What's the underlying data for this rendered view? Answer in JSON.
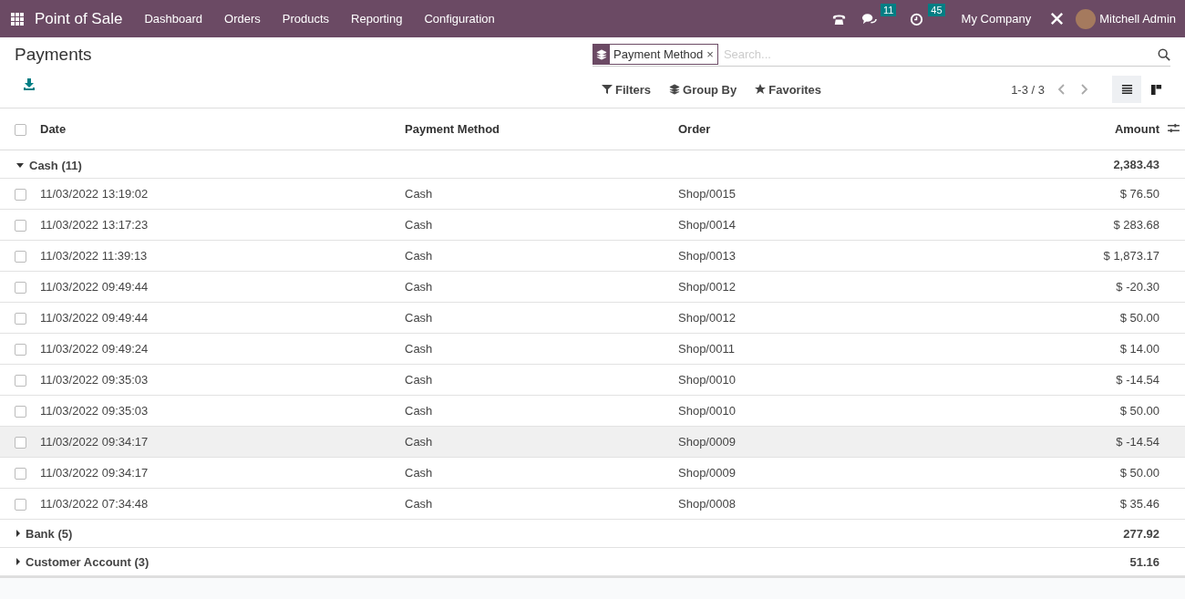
{
  "navbar": {
    "app_title": "Point of Sale",
    "menu": [
      "Dashboard",
      "Orders",
      "Products",
      "Reporting",
      "Configuration"
    ],
    "messages_count": "11",
    "activities_count": "45",
    "company": "My Company",
    "user": "Mitchell Admin"
  },
  "control_panel": {
    "title": "Payments",
    "facet": "Payment Method",
    "facet_remove": "×",
    "search": {
      "placeholder": "Search..."
    },
    "filters": "Filters",
    "group_by": "Group By",
    "favorites": "Favorites",
    "pager": "1-3 / 3",
    "views": [
      {
        "kind": "list",
        "selected": true
      },
      {
        "kind": "kanban",
        "selected": false
      }
    ]
  },
  "table": {
    "columns": [
      "Date",
      "Payment Method",
      "Order",
      "Amount"
    ],
    "select_all_checked": false,
    "groups": [
      {
        "label": "Cash (11)",
        "total": "2,383.43",
        "expanded": true,
        "rows": [
          {
            "date": "11/03/2022 13:19:02",
            "method": "Cash",
            "order": "Shop/0015",
            "amount": "$ 76.50",
            "highlighted": false
          },
          {
            "date": "11/03/2022 13:17:23",
            "method": "Cash",
            "order": "Shop/0014",
            "amount": "$ 283.68",
            "highlighted": false
          },
          {
            "date": "11/03/2022 11:39:13",
            "method": "Cash",
            "order": "Shop/0013",
            "amount": "$ 1,873.17",
            "highlighted": false
          },
          {
            "date": "11/03/2022 09:49:44",
            "method": "Cash",
            "order": "Shop/0012",
            "amount": "$ -20.30",
            "highlighted": false
          },
          {
            "date": "11/03/2022 09:49:44",
            "method": "Cash",
            "order": "Shop/0012",
            "amount": "$ 50.00",
            "highlighted": false
          },
          {
            "date": "11/03/2022 09:49:24",
            "method": "Cash",
            "order": "Shop/0011",
            "amount": "$ 14.00",
            "highlighted": false
          },
          {
            "date": "11/03/2022 09:35:03",
            "method": "Cash",
            "order": "Shop/0010",
            "amount": "$ -14.54",
            "highlighted": false
          },
          {
            "date": "11/03/2022 09:35:03",
            "method": "Cash",
            "order": "Shop/0010",
            "amount": "$ 50.00",
            "highlighted": false
          },
          {
            "date": "11/03/2022 09:34:17",
            "method": "Cash",
            "order": "Shop/0009",
            "amount": "$ -14.54",
            "highlighted": true
          },
          {
            "date": "11/03/2022 09:34:17",
            "method": "Cash",
            "order": "Shop/0009",
            "amount": "$ 50.00",
            "highlighted": false
          },
          {
            "date": "11/03/2022 07:34:48",
            "method": "Cash",
            "order": "Shop/0008",
            "amount": "$ 35.46",
            "highlighted": false
          }
        ]
      },
      {
        "label": "Bank (5)",
        "total": "277.92",
        "expanded": false
      },
      {
        "label": "Customer Account (3)",
        "total": "51.16",
        "expanded": false
      }
    ]
  }
}
